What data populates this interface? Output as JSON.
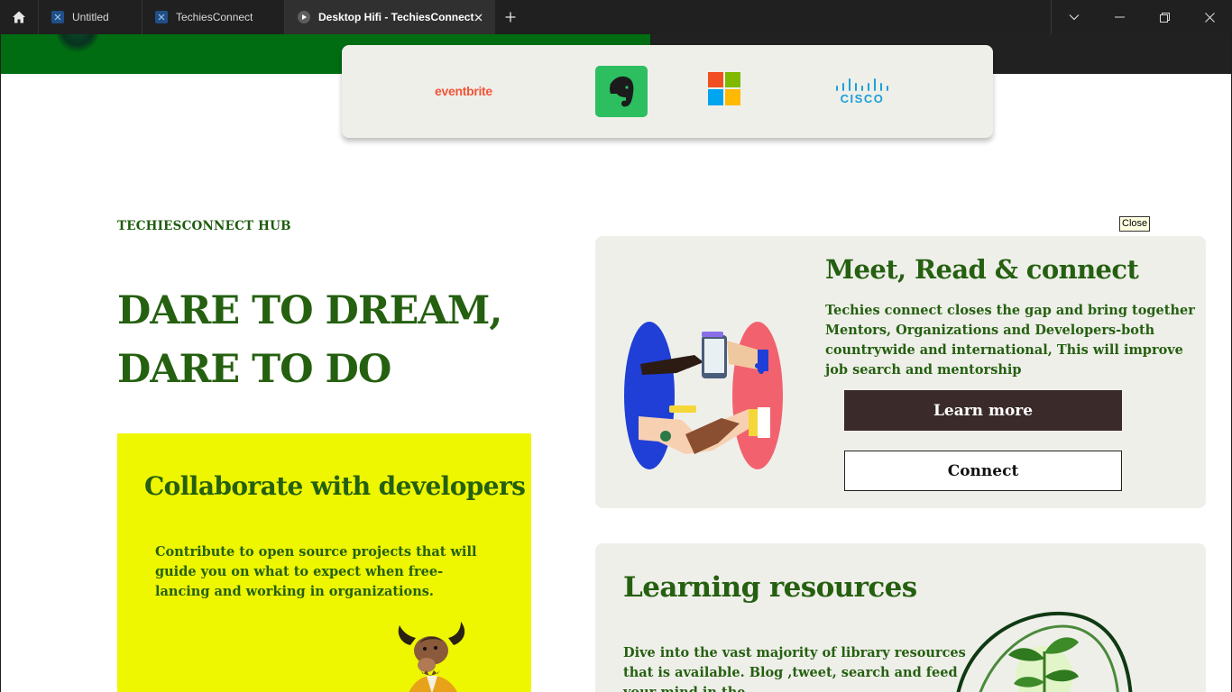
{
  "browser": {
    "tabs": [
      {
        "label": "Untitled",
        "icon": "figma-file-icon"
      },
      {
        "label": "TechiesConnect",
        "icon": "figma-file-icon"
      },
      {
        "label": "Desktop Hifi - TechiesConnect",
        "icon": "play-icon",
        "active": true
      }
    ],
    "new_tab_icon": "plus-icon",
    "controls": [
      "chevron-down-icon",
      "minimize-icon",
      "restore-icon",
      "close-icon"
    ]
  },
  "partners": {
    "eventbrite": "eventbrite",
    "evernote_icon": "evernote-elephant-icon",
    "microsoft_icon": "microsoft-logo",
    "cisco": "CISCO"
  },
  "tooltip": {
    "close": "Close"
  },
  "hero": {
    "eyebrow": "TECHIESCONNECT HUB",
    "headline_line1": "DARE TO DREAM,",
    "headline_line2": "DARE TO DO"
  },
  "collaborate": {
    "title": "Collaborate with developers",
    "text": "Contribute to open source projects that will guide you on what to expect when free-lancing and working in organizations."
  },
  "meet": {
    "title": "Meet, Read & connect",
    "text": "Techies connect closes the gap and bring together Mentors, Organizations and Developers-both countrywide and international, This will improve job search and mentorship",
    "learn_more": "Learn more",
    "connect": "Connect"
  },
  "learning": {
    "title": "Learning resources",
    "text": "Dive into the vast majority of library resources that is available. Blog ,tweet, search and feed your mind in the"
  },
  "colors": {
    "brand_green": "#256010",
    "hero_green": "#006d12",
    "accent_yellow": "#eef600",
    "button_dark": "#3a2a2a",
    "card_bg": "#efefea"
  }
}
